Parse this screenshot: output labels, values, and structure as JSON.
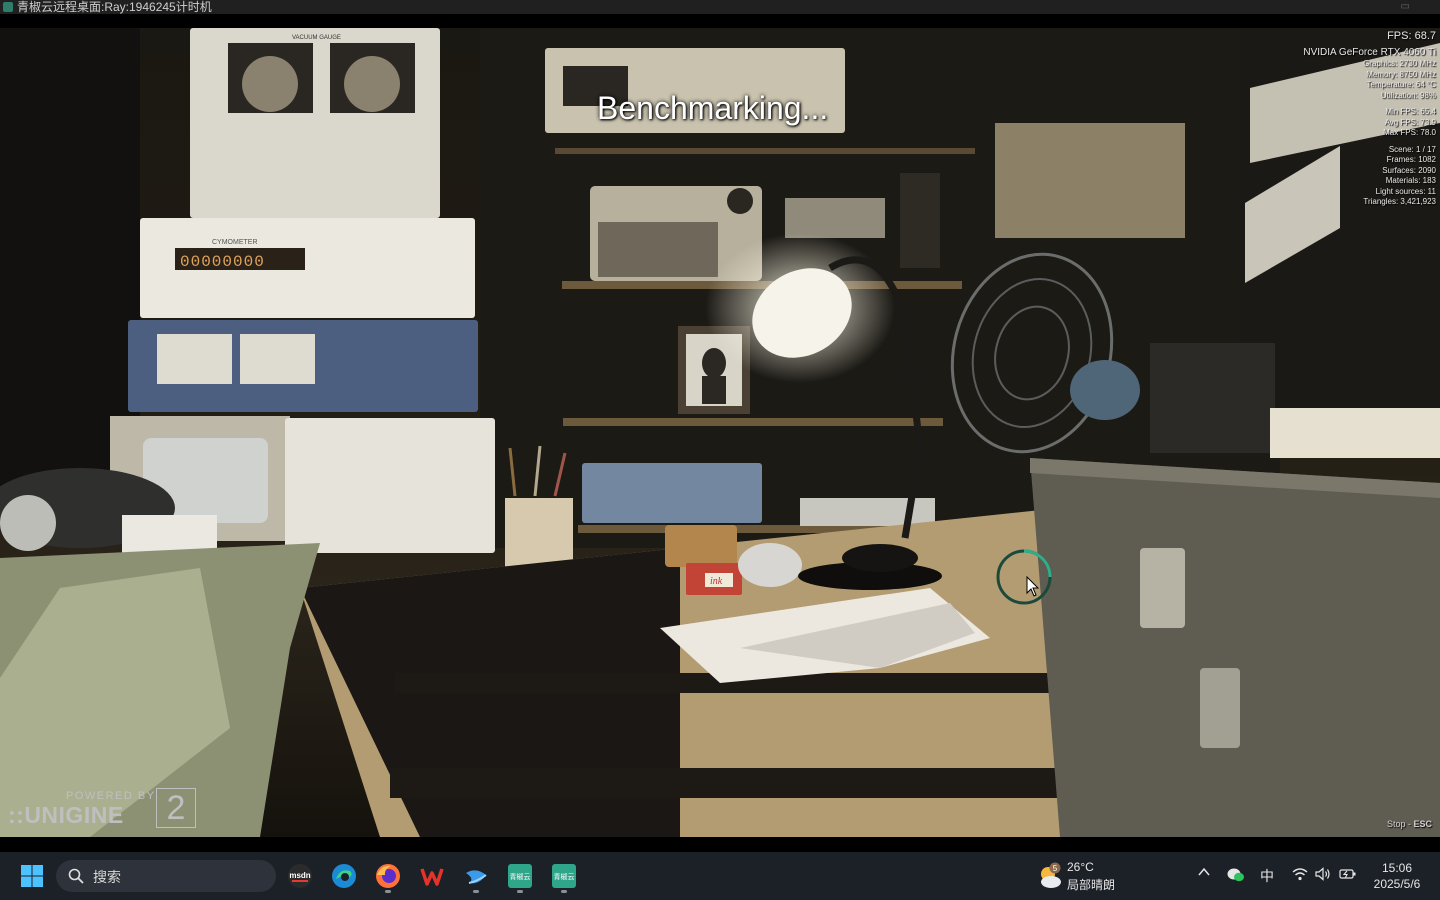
{
  "window": {
    "title": "青椒云远程桌面:Ray:1946245计时机"
  },
  "benchmark": {
    "status_text": "Benchmarking...",
    "stats": {
      "fps": "FPS: 68.7",
      "gpu_name": "NVIDIA GeForce RTX 4060 Ti",
      "graphics": "Graphics: 2730 MHz",
      "memory": "Memory: 8750 MHz",
      "temperature": "Temperature: 64 °C",
      "utilization": "Utilization: 98%",
      "min_fps": "Min FPS: 65.4",
      "avg_fps": "Avg FPS: 73.9",
      "max_fps": "Max FPS: 78.0",
      "scene": "Scene: 1 / 17",
      "frames": "Frames: 1082",
      "surfaces": "Surfaces: 2090",
      "materials": "Materials: 183",
      "light_sources": "Light sources: 11",
      "triangles": "Triangles: 3,421,923"
    },
    "branding": {
      "powered_by": "POWERED BY",
      "brand": "::UNIGINE",
      "version": "2"
    },
    "stop_hint": {
      "label": "Stop - ",
      "key": "ESC"
    },
    "scene_labels": {
      "vacuum_gauge": "VACUUM GAUGE",
      "cymometer": "CYMOMETER",
      "counter": "00000000",
      "ink_box": "ink"
    }
  },
  "taskbar": {
    "search_placeholder": "搜索",
    "apps": [
      {
        "name": "msdn",
        "label": "msdn"
      },
      {
        "name": "edge",
        "label": ""
      },
      {
        "name": "firefox",
        "label": ""
      },
      {
        "name": "wps",
        "label": ""
      },
      {
        "name": "app-blue",
        "label": ""
      },
      {
        "name": "qingjiaoyun-1",
        "label": "青椒云"
      },
      {
        "name": "qingjiaoyun-2",
        "label": "青椒云"
      }
    ],
    "weather": {
      "badge": "5",
      "temp": "26°C",
      "desc": "局部晴朗"
    },
    "ime": "中",
    "clock": {
      "time": "15:06",
      "date": "2025/5/6"
    }
  }
}
